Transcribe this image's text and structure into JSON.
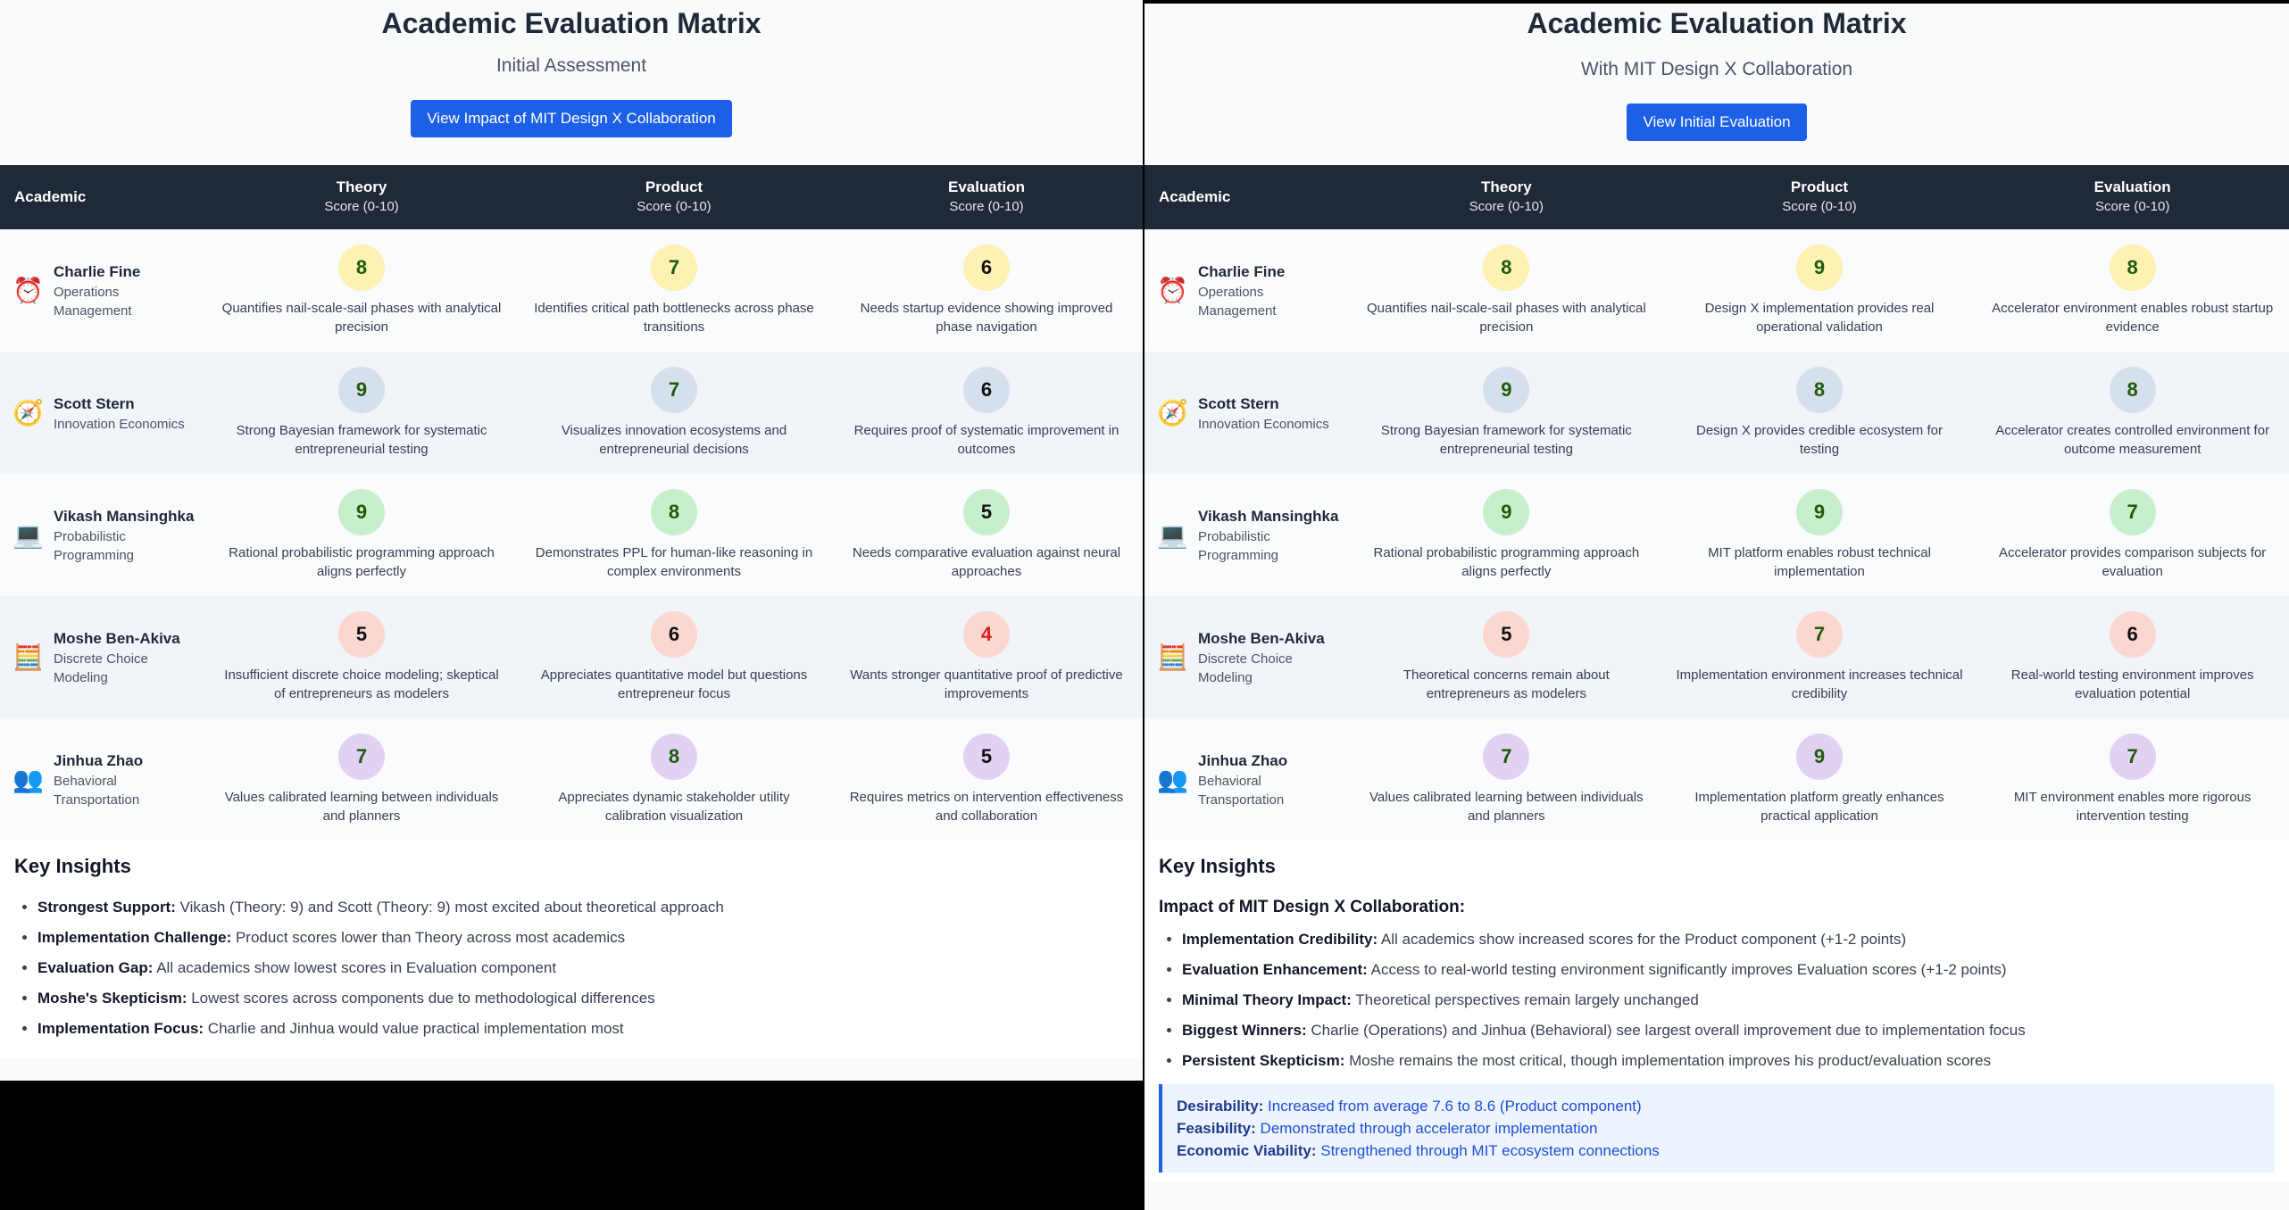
{
  "left": {
    "title": "Academic Evaluation Matrix",
    "subtitle": "Initial Assessment",
    "button_label": "View Impact of MIT Design X Collaboration",
    "headers": {
      "academic": "Academic",
      "theory": "Theory",
      "product": "Product",
      "evaluation": "Evaluation",
      "score_range": "Score (0-10)"
    },
    "rows": [
      {
        "name": "Charlie Fine",
        "field": "Operations Management",
        "icon": "alarm-clock-icon",
        "theory": {
          "score": "8",
          "comment": "Quantifies nail-scale-sail phases with analytical precision"
        },
        "product": {
          "score": "7",
          "comment": "Identifies critical path bottlenecks across phase transitions"
        },
        "evaluation": {
          "score": "6",
          "comment": "Needs startup evidence showing improved phase navigation"
        }
      },
      {
        "name": "Scott Stern",
        "field": "Innovation Economics",
        "icon": "compass-icon",
        "theory": {
          "score": "9",
          "comment": "Strong Bayesian framework for systematic entrepreneurial testing"
        },
        "product": {
          "score": "7",
          "comment": "Visualizes innovation ecosystems and entrepreneurial decisions"
        },
        "evaluation": {
          "score": "6",
          "comment": "Requires proof of systematic improvement in outcomes"
        }
      },
      {
        "name": "Vikash Mansinghka",
        "field": "Probabilistic Programming",
        "icon": "laptop-icon",
        "theory": {
          "score": "9",
          "comment": "Rational probabilistic programming approach aligns perfectly"
        },
        "product": {
          "score": "8",
          "comment": "Demonstrates PPL for human-like reasoning in complex environments"
        },
        "evaluation": {
          "score": "5",
          "comment": "Needs comparative evaluation against neural approaches"
        }
      },
      {
        "name": "Moshe Ben-Akiva",
        "field": "Discrete Choice Modeling",
        "icon": "abacus-icon",
        "theory": {
          "score": "5",
          "comment": "Insufficient discrete choice modeling; skeptical of entrepreneurs as modelers"
        },
        "product": {
          "score": "6",
          "comment": "Appreciates quantitative model but questions entrepreneur focus"
        },
        "evaluation": {
          "score": "4",
          "comment": "Wants stronger quantitative proof of predictive improvements"
        }
      },
      {
        "name": "Jinhua Zhao",
        "field": "Behavioral Transportation",
        "icon": "people-icon",
        "theory": {
          "score": "7",
          "comment": "Values calibrated learning between individuals and planners"
        },
        "product": {
          "score": "8",
          "comment": "Appreciates dynamic stakeholder utility calibration visualization"
        },
        "evaluation": {
          "score": "5",
          "comment": "Requires metrics on intervention effectiveness and collaboration"
        }
      }
    ],
    "insights": {
      "heading": "Key Insights",
      "items": [
        {
          "label": "Strongest Support:",
          "text": " Vikash (Theory: 9) and Scott (Theory: 9) most excited about theoretical approach"
        },
        {
          "label": "Implementation Challenge:",
          "text": " Product scores lower than Theory across most academics"
        },
        {
          "label": "Evaluation Gap:",
          "text": " All academics show lowest scores in Evaluation component"
        },
        {
          "label": "Moshe's Skepticism:",
          "text": " Lowest scores across components due to methodological differences"
        },
        {
          "label": "Implementation Focus:",
          "text": " Charlie and Jinhua would value practical implementation most"
        }
      ]
    }
  },
  "right": {
    "title": "Academic Evaluation Matrix",
    "subtitle": "With MIT Design X Collaboration",
    "button_label": "View Initial Evaluation",
    "headers": {
      "academic": "Academic",
      "theory": "Theory",
      "product": "Product",
      "evaluation": "Evaluation",
      "score_range": "Score (0-10)"
    },
    "rows": [
      {
        "name": "Charlie Fine",
        "field": "Operations Management",
        "icon": "alarm-clock-icon",
        "theory": {
          "score": "8",
          "comment": "Quantifies nail-scale-sail phases with analytical precision"
        },
        "product": {
          "score": "9",
          "comment": "Design X implementation provides real operational validation"
        },
        "evaluation": {
          "score": "8",
          "comment": "Accelerator environment enables robust startup evidence"
        }
      },
      {
        "name": "Scott Stern",
        "field": "Innovation Economics",
        "icon": "compass-icon",
        "theory": {
          "score": "9",
          "comment": "Strong Bayesian framework for systematic entrepreneurial testing"
        },
        "product": {
          "score": "8",
          "comment": "Design X provides credible ecosystem for testing"
        },
        "evaluation": {
          "score": "8",
          "comment": "Accelerator creates controlled environment for outcome measurement"
        }
      },
      {
        "name": "Vikash Mansinghka",
        "field": "Probabilistic Programming",
        "icon": "laptop-icon",
        "theory": {
          "score": "9",
          "comment": "Rational probabilistic programming approach aligns perfectly"
        },
        "product": {
          "score": "9",
          "comment": "MIT platform enables robust technical implementation"
        },
        "evaluation": {
          "score": "7",
          "comment": "Accelerator provides comparison subjects for evaluation"
        }
      },
      {
        "name": "Moshe Ben-Akiva",
        "field": "Discrete Choice Modeling",
        "icon": "abacus-icon",
        "theory": {
          "score": "5",
          "comment": "Theoretical concerns remain about entrepreneurs as modelers"
        },
        "product": {
          "score": "7",
          "comment": "Implementation environment increases technical credibility"
        },
        "evaluation": {
          "score": "6",
          "comment": "Real-world testing environment improves evaluation potential"
        }
      },
      {
        "name": "Jinhua Zhao",
        "field": "Behavioral Transportation",
        "icon": "people-icon",
        "theory": {
          "score": "7",
          "comment": "Values calibrated learning between individuals and planners"
        },
        "product": {
          "score": "9",
          "comment": "Implementation platform greatly enhances practical application"
        },
        "evaluation": {
          "score": "7",
          "comment": "MIT environment enables more rigorous intervention testing"
        }
      }
    ],
    "insights": {
      "heading": "Key Insights",
      "subheading": "Impact of MIT Design X Collaboration:",
      "items": [
        {
          "label": "Implementation Credibility:",
          "text": " All academics show increased scores for the Product component (+1-2 points)"
        },
        {
          "label": "Evaluation Enhancement:",
          "text": " Access to real-world testing environment significantly improves Evaluation scores (+1-2 points)"
        },
        {
          "label": "Minimal Theory Impact:",
          "text": " Theoretical perspectives remain largely unchanged"
        },
        {
          "label": "Biggest Winners:",
          "text": " Charlie (Operations) and Jinhua (Behavioral) see largest overall improvement due to implementation focus"
        },
        {
          "label": "Persistent Skepticism:",
          "text": " Moshe remains the most critical, though implementation improves his product/evaluation scores"
        }
      ],
      "summary": [
        {
          "label": "Desirability:",
          "text": " Increased from average 7.6 to 8.6 (Product component)"
        },
        {
          "label": "Feasibility:",
          "text": " Demonstrated through accelerator implementation"
        },
        {
          "label": "Economic Viability:",
          "text": " Strengthened through MIT ecosystem connections"
        }
      ]
    }
  },
  "colors": {
    "header_bg": "#1f2937",
    "button_bg": "#1d5fe6",
    "score_yellow": "#fdf1b3",
    "score_blue": "#d6e0ec",
    "score_green": "#c8efcc",
    "score_red": "#fcd7d0",
    "score_purple": "#e1d2f3",
    "warning_text": "#e11d1d"
  }
}
